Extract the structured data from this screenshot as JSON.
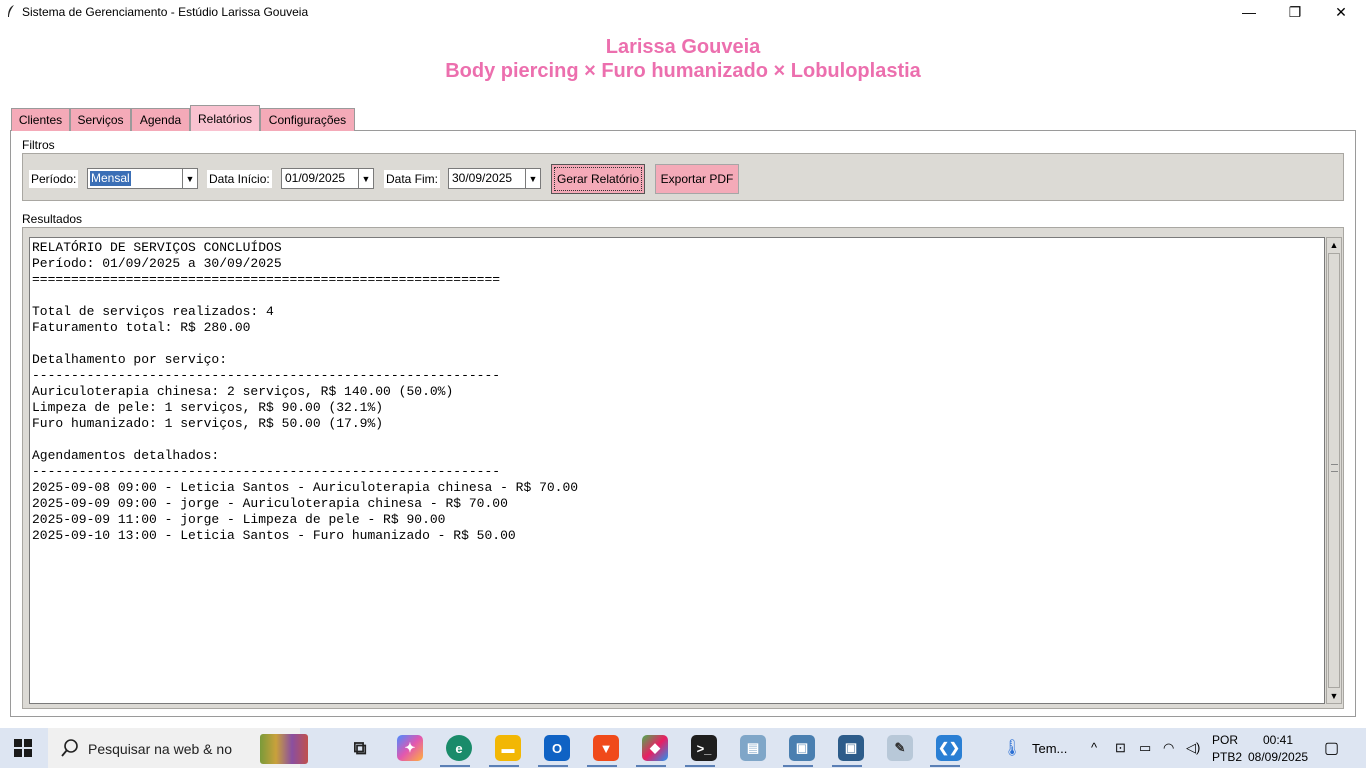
{
  "window": {
    "title": "Sistema de Gerenciamento - Estúdio Larissa Gouveia",
    "minimize": "—",
    "maximize": "❐",
    "close": "✕"
  },
  "header": {
    "name": "Larissa Gouveia",
    "subtitle": "Body piercing × Furo humanizado × Lobuloplastia",
    "color": "#ec6fae"
  },
  "tabs": [
    {
      "label": "Clientes",
      "active": false
    },
    {
      "label": "Serviços",
      "active": false
    },
    {
      "label": "Agenda",
      "active": false
    },
    {
      "label": "Relatórios",
      "active": true
    },
    {
      "label": "Configurações",
      "active": false
    }
  ],
  "filters": {
    "group_label": "Filtros",
    "periodo_label": "Período:",
    "periodo_value": "Mensal",
    "data_inicio_label": "Data Início:",
    "data_inicio_value": "01/09/2025",
    "data_fim_label": "Data Fim:",
    "data_fim_value": "30/09/2025",
    "gerar_button": "Gerar Relatório",
    "exportar_button": "Exportar PDF"
  },
  "results": {
    "group_label": "Resultados",
    "lines": [
      "RELATÓRIO DE SERVIÇOS CONCLUÍDOS",
      "Período: 01/09/2025 a 30/09/2025",
      "============================================================",
      "",
      "Total de serviços realizados: 4",
      "Faturamento total: R$ 280.00",
      "",
      "Detalhamento por serviço:",
      "------------------------------------------------------------",
      "Auriculoterapia chinesa: 2 serviços, R$ 140.00 (50.0%)",
      "Limpeza de pele: 1 serviços, R$ 90.00 (32.1%)",
      "Furo humanizado: 1 serviços, R$ 50.00 (17.9%)",
      "",
      "Agendamentos detalhados:",
      "------------------------------------------------------------",
      "2025-09-08 09:00 - Leticia Santos - Auriculoterapia chinesa - R$ 70.00",
      "2025-09-09 09:00 - jorge - Auriculoterapia chinesa - R$ 70.00",
      "2025-09-09 11:00 - jorge - Limpeza de pele - R$ 90.00",
      "2025-09-10 13:00 - Leticia Santos - Furo humanizado - R$ 50.00"
    ]
  },
  "taskbar": {
    "search_placeholder": "Pesquisar na web & no",
    "weather_text": "Tem...",
    "language_line1": "POR",
    "language_line2": "PTB2",
    "time": "00:41",
    "date": "08/09/2025"
  }
}
